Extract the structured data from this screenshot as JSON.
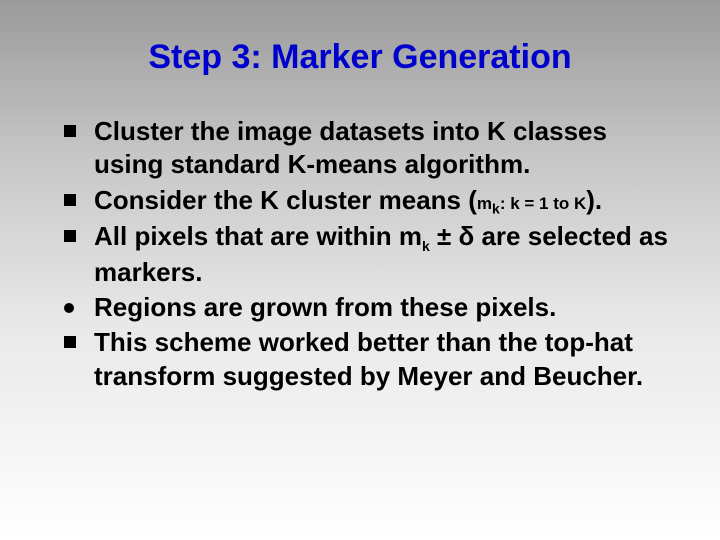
{
  "title": "Step 3: Marker Generation",
  "items": [
    {
      "kind": "square",
      "html": "Cluster the image datasets into K classes using standard K-means algorithm."
    },
    {
      "kind": "square",
      "html": "Consider the K cluster means (<span class=\"sub\">m<span class=\"subk\">k</span>: k = 1 to K</span>)."
    },
    {
      "kind": "square",
      "html": "All pixels that are within m<span class=\"subk\">k</span> ± δ are selected as markers."
    },
    {
      "kind": "round",
      "html": "Regions are grown from these pixels."
    },
    {
      "kind": "square",
      "html": "This scheme worked better than the top-hat transform suggested by Meyer and Beucher."
    }
  ]
}
